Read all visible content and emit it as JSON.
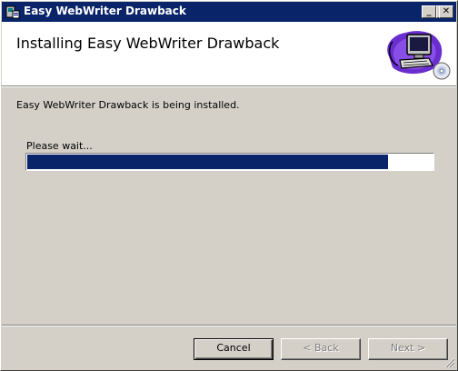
{
  "window": {
    "title": "Easy WebWriter Drawback",
    "controls": {
      "minimize": "_",
      "maximize": "□",
      "close": "✕"
    }
  },
  "header": {
    "title": "Installing Easy WebWriter Drawback",
    "graphic_icon": "computer-with-cd-icon"
  },
  "body": {
    "status_message": "Easy WebWriter Drawback is being installed.",
    "wait_label": "Please wait..."
  },
  "progress": {
    "fraction": 0.89,
    "color": "#0a246a"
  },
  "buttons": {
    "cancel": "Cancel",
    "back": "< Back",
    "next": "Next >"
  },
  "colors": {
    "titlebar": "#0a246a",
    "face": "#d4d0c8",
    "header_bg": "#ffffff"
  }
}
